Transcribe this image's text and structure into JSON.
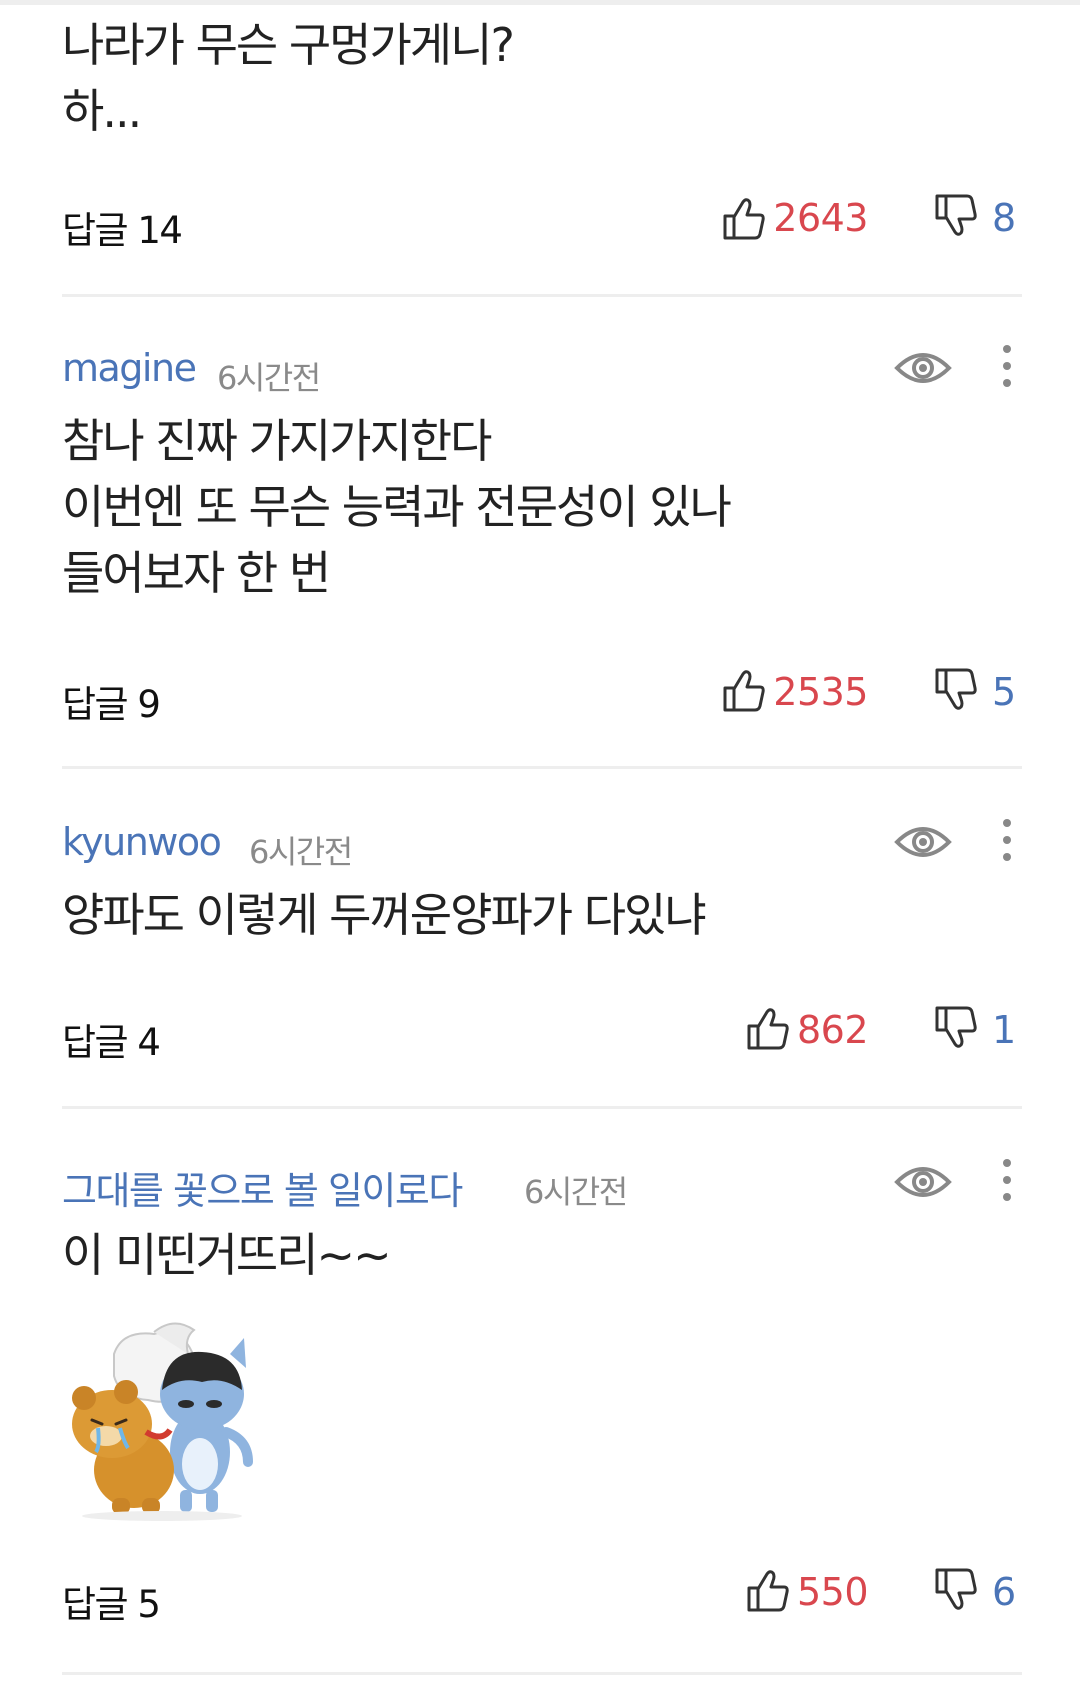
{
  "comments": [
    {
      "body": [
        "나라가 무슨 구멍가게니?",
        "하..."
      ],
      "reply_label": "답글 14",
      "likes": "2643",
      "dislikes": "8"
    },
    {
      "author": "magine",
      "time": "6시간전",
      "body": [
        "참나 진짜 가지가지한다",
        "이번엔 또 무슨 능력과 전문성이 있나",
        "들어보자 한 번"
      ],
      "reply_label": "답글 9",
      "likes": "2535",
      "dislikes": "5"
    },
    {
      "author": "kyunwoo",
      "time": "6시간전",
      "body": [
        "양파도 이렇게 두꺼운양파가  다있냐"
      ],
      "reply_label": "답글 4",
      "likes": "862",
      "dislikes": "1"
    },
    {
      "author": "그대를 꽃으로 볼 일이로다",
      "time": "6시간전",
      "body": [
        "이   미띤거뜨리~~"
      ],
      "sticker": "kakao-friends-ryan-and-neo-pillow-sticker",
      "reply_label": "답글 5",
      "likes": "550",
      "dislikes": "6"
    }
  ],
  "icons": {
    "like": "thumbs-up-icon",
    "dislike": "thumbs-down-icon",
    "hide": "eye-icon",
    "more": "more-vertical-icon"
  },
  "colors": {
    "author": "#4a74b7",
    "likes": "#d9474e",
    "dislikes": "#4a74b7",
    "divider": "#eeeeee"
  }
}
